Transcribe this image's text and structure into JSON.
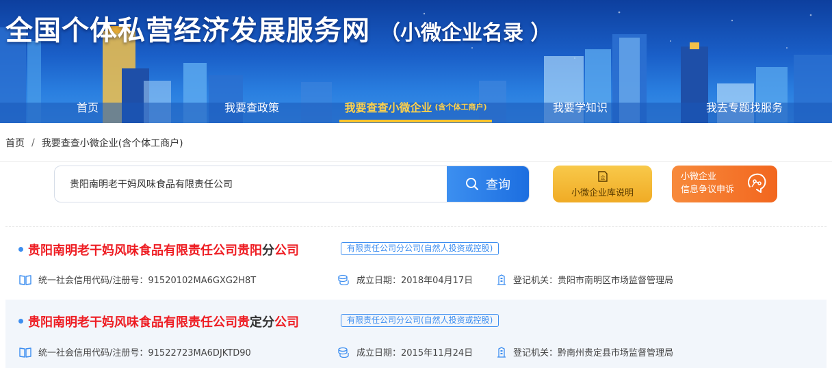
{
  "header": {
    "title": "全国个体私营经济发展服务网",
    "subtitle": "（小微企业名录 ）"
  },
  "nav": {
    "items": [
      {
        "label": "首页"
      },
      {
        "label": "我要查政策"
      },
      {
        "label": "我要查查小微企业",
        "note": "(含个体工商户)",
        "active": true
      },
      {
        "label": "我要学知识"
      },
      {
        "label": "我去专题找服务"
      }
    ]
  },
  "breadcrumb": {
    "home": "首页",
    "separator": "/",
    "current": "我要查查小微企业(含个体工商户)"
  },
  "search": {
    "value": "贵阳南明老干妈风味食品有限责任公司",
    "button_label": "查询"
  },
  "actions": {
    "guide_label": "小微企业库说明",
    "appeal_line1": "小微企业",
    "appeal_line2": "信息争议申诉"
  },
  "results": [
    {
      "name_highlight": "贵阳南明老干妈风味食品有限责任公司贵阳",
      "name_plain": "分",
      "name_highlight_end": "公司",
      "type": "有限责任公司分公司(自然人投资或控股)",
      "credit_code": "统一社会信用代码/注册号：91520102MA6GXG2H8T",
      "established": "成立日期：2018年04月17日",
      "authority": "登记机关：贵阳市南明区市场监督管理局"
    },
    {
      "name_highlight": "贵阳南明老干妈风味食品有限责任公司贵",
      "name_plain": "定分",
      "name_highlight_end": "公司",
      "type": "有限责任公司分公司(自然人投资或控股)",
      "credit_code": "统一社会信用代码/注册号：91522723MA6DJKTD90",
      "established": "成立日期：2015年11月24日",
      "authority": "登记机关：黔南州贵定县市场监督管理局"
    }
  ],
  "colors": {
    "accent_blue": "#3d8ef0",
    "highlight_red": "#ee1d23",
    "nav_active": "#ffd24a",
    "guide_yellow": "#f4b933",
    "appeal_orange": "#f4701f"
  },
  "icons": [
    "search-icon",
    "enterprise-doc-icon",
    "appeal-icon",
    "book-icon",
    "coins-icon",
    "building-icon"
  ]
}
